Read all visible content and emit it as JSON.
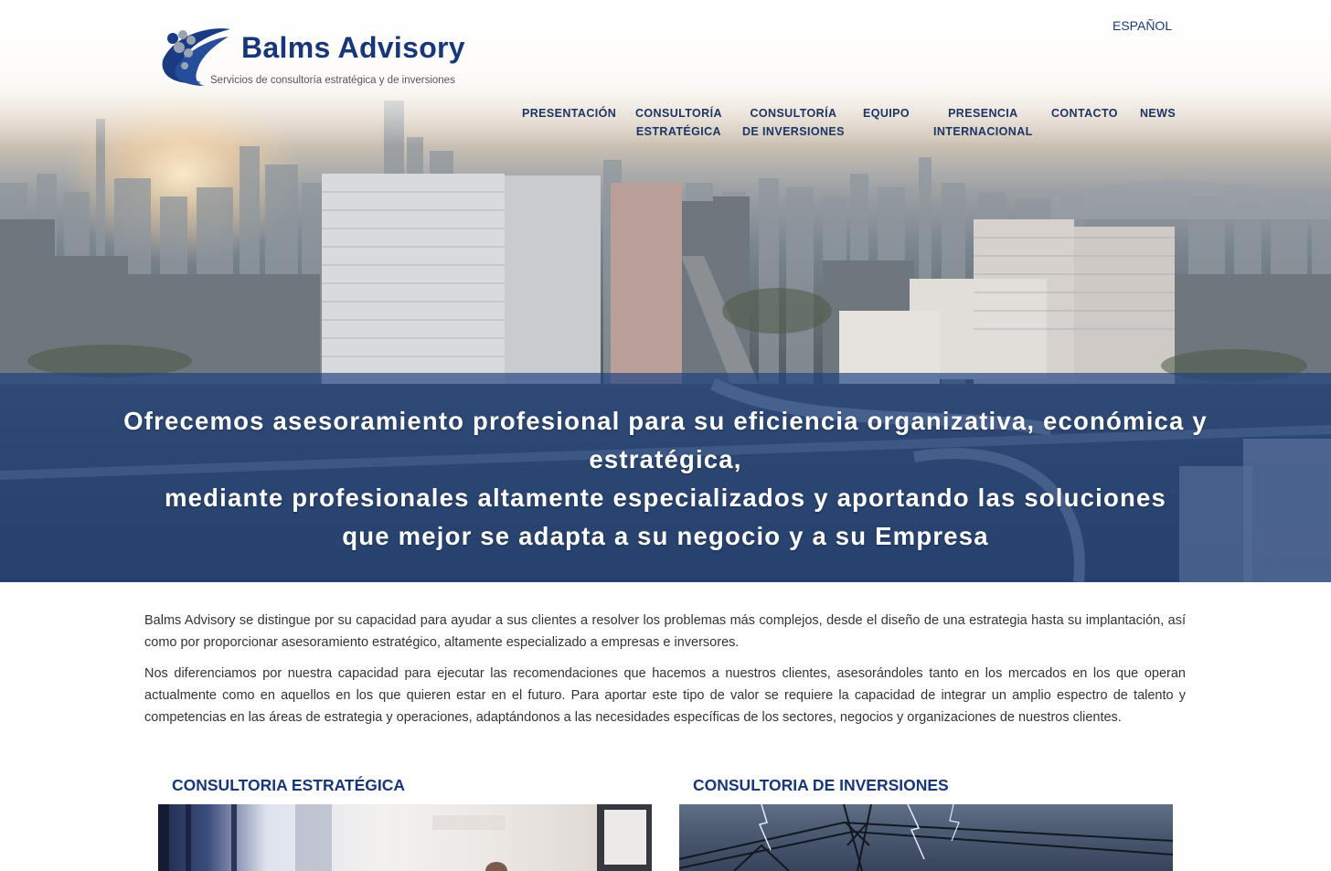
{
  "header": {
    "brand_name": "Balms Advisory",
    "brand_tagline": "Servicios de consultoría estratégica y de inversiones",
    "language": "ESPAÑOL"
  },
  "nav": {
    "items": [
      {
        "line1": "PRESENTACIÓN",
        "line2": ""
      },
      {
        "line1": "CONSULTORÍA",
        "line2": "ESTRATÉGICA"
      },
      {
        "line1": "CONSULTORÍA",
        "line2": "DE INVERSIONES"
      },
      {
        "line1": "EQUIPO",
        "line2": ""
      },
      {
        "line1": "PRESENCIA",
        "line2": "INTERNACIONAL"
      },
      {
        "line1": "CONTACTO",
        "line2": ""
      },
      {
        "line1": "NEWS",
        "line2": ""
      }
    ]
  },
  "hero": {
    "line1": "Ofrecemos asesoramiento profesional para su eficiencia organizativa, económica y",
    "line2": "estratégica,",
    "line3": "mediante profesionales altamente especializados y aportando las soluciones",
    "line4": "que mejor se adapta a su negocio y a su Empresa"
  },
  "intro": {
    "p1": "Balms Advisory se distingue por su capacidad para ayudar a sus clientes a resolver los problemas más complejos, desde el diseño de una estrategia hasta su implantación, así como por proporcionar asesoramiento estratégico, altamente especializado a empresas e inversores.",
    "p2": "Nos diferenciamos por nuestra capacidad para ejecutar las recomendaciones que hacemos a nuestros clientes, asesorándoles tanto en los mercados en los que operan actualmente como en aquellos en los que quieren estar en el futuro. Para aportar este tipo de valor se requiere la capacidad de integrar un amplio espectro de talento y competencias en las áreas de estrategia y operaciones, adaptándonos a las necesidades específicas de los sectores, negocios y organizaciones de nuestros clientes."
  },
  "cards": {
    "strategic_title": "CONSULTORIA ESTRATÉGICA",
    "investment_title": "CONSULTORIA DE INVERSIONES"
  },
  "colors": {
    "brand_blue": "#17377a",
    "band_blue": "#1c4080"
  }
}
